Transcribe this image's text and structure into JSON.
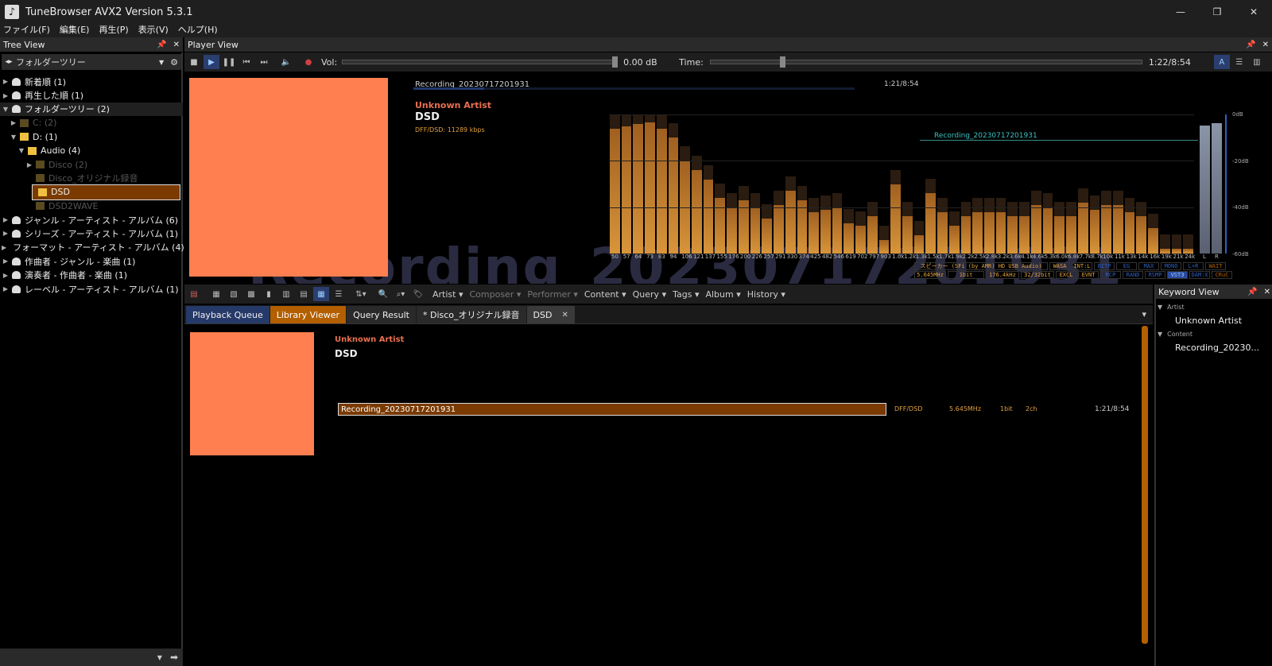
{
  "window": {
    "title": "TuneBrowser AVX2 Version 5.3.1",
    "minimize": "—",
    "restore": "❐",
    "close": "✕"
  },
  "menu": [
    "ファイル(F)",
    "編集(E)",
    "再生(P)",
    "表示(V)",
    "ヘルプ(H)"
  ],
  "tree": {
    "header": "Tree View",
    "dropdown_value": "フォルダーツリー",
    "items": [
      {
        "label": "新着順 (1)",
        "level": 0,
        "arrow": "▶",
        "icon": "root",
        "style": ""
      },
      {
        "label": "再生した順 (1)",
        "level": 0,
        "arrow": "▶",
        "icon": "root",
        "style": ""
      },
      {
        "label": "フォルダーツリー (2)",
        "level": 0,
        "arrow": "▼",
        "icon": "root",
        "style": "hl"
      },
      {
        "label": "C: (2)",
        "level": 1,
        "arrow": "▶",
        "icon": "dim",
        "style": "dim"
      },
      {
        "label": "D: (1)",
        "level": 1,
        "arrow": "▼",
        "icon": "folder",
        "style": ""
      },
      {
        "label": "Audio (4)",
        "level": 2,
        "arrow": "▼",
        "icon": "folder",
        "style": ""
      },
      {
        "label": "Disco (2)",
        "level": 3,
        "arrow": "▶",
        "icon": "dim",
        "style": "dim"
      },
      {
        "label": "Disco_オリジナル録音",
        "level": 3,
        "arrow": "",
        "icon": "dim",
        "style": "dim"
      },
      {
        "label": "DSD",
        "level": 3,
        "arrow": "",
        "icon": "folder",
        "style": "selected"
      },
      {
        "label": "DSD2WAVE",
        "level": 3,
        "arrow": "",
        "icon": "dim",
        "style": "dim"
      },
      {
        "label": "ジャンル - アーティスト - アルバム (6)",
        "level": 0,
        "arrow": "▶",
        "icon": "root",
        "style": ""
      },
      {
        "label": "シリーズ - アーティスト - アルバム (1)",
        "level": 0,
        "arrow": "▶",
        "icon": "root",
        "style": ""
      },
      {
        "label": "フォーマット - アーティスト - アルバム (4)",
        "level": 0,
        "arrow": "▶",
        "icon": "root",
        "style": ""
      },
      {
        "label": "作曲者 - ジャンル - 楽曲 (1)",
        "level": 0,
        "arrow": "▶",
        "icon": "root",
        "style": ""
      },
      {
        "label": "演奏者 - 作曲者 - 楽曲 (1)",
        "level": 0,
        "arrow": "▶",
        "icon": "root",
        "style": ""
      },
      {
        "label": "レーベル - アーティスト - アルバム (1)",
        "level": 0,
        "arrow": "▶",
        "icon": "root",
        "style": ""
      }
    ]
  },
  "player": {
    "header": "Player View",
    "vol_label": "Vol:",
    "vol_value": "0.00 dB",
    "vol_position": 0.99,
    "time_label": "Time:",
    "time_value": "1:22/8:54",
    "time_position": 0.16,
    "track_title": "Recording_20230717201931",
    "track_time": "1:21/8:54",
    "progress": 0.16,
    "artist": "Unknown Artist",
    "album": "DSD",
    "format": "DFF/DSD: 11289 kbps",
    "spectrum_title": "Recording_20230717201931",
    "watermark": "Recording_20230717201931",
    "db_labels": [
      "0dB",
      "-20dB",
      "-40dB",
      "-60dB"
    ],
    "freq_labels": [
      "50",
      "57",
      "64",
      "73",
      "83",
      "94",
      "106",
      "121",
      "137",
      "155",
      "176",
      "200",
      "226",
      "257",
      "291",
      "330",
      "374",
      "425",
      "482",
      "546",
      "619",
      "702",
      "797",
      "903",
      "1.0k",
      "1.2k",
      "1.3k",
      "1.5k",
      "1.7k",
      "1.9k",
      "2.2k",
      "2.5k",
      "2.8k",
      "3.2k",
      "3.6k",
      "4.1k",
      "4.6k",
      "5.3k",
      "6.0k",
      "6.8k",
      "7.7k",
      "8.7k",
      "10k",
      "11k",
      "13k",
      "14k",
      "16k",
      "19k",
      "21k",
      "24k"
    ],
    "spectrum_levels": [
      -6,
      -5,
      -4,
      -3.5,
      -6,
      -10,
      -20,
      -24,
      -28,
      -36,
      -40,
      -37,
      -40,
      -45,
      -39,
      -33,
      -37,
      -42,
      -41,
      -40,
      -47,
      -48,
      -44,
      -54,
      -30,
      -44,
      -52,
      -34,
      -42,
      -48,
      -44,
      -42,
      -42,
      -42,
      -44,
      -44,
      -39,
      -40,
      -44,
      -44,
      -38,
      -41,
      -39,
      -39,
      -42,
      -44,
      -49,
      -58,
      -58,
      -58
    ],
    "vu_channels": [
      "L",
      "R"
    ],
    "device_row1": [
      "スピーカー (SFi (by AMR) HD USB Audio)",
      "WASA",
      "INT:L",
      "BITP",
      "EG",
      "MAX",
      "MONO",
      "L+R",
      "WAIT"
    ],
    "device_row2": [
      "5.645MHz",
      "1bit",
      "176.4kHz",
      "32/32bit",
      "EXCL",
      "EVNT",
      "RCP",
      "RAND",
      "RSMP",
      "VST3",
      "DAM:X",
      "CRuC"
    ]
  },
  "library": {
    "toolbar_items": [
      {
        "label": "Artist ▾",
        "dim": false
      },
      {
        "label": "Composer ▾",
        "dim": true
      },
      {
        "label": "Performer ▾",
        "dim": true
      },
      {
        "label": "Content ▾",
        "dim": false
      },
      {
        "label": "Query ▾",
        "dim": false
      },
      {
        "label": "Tags ▾",
        "dim": false
      },
      {
        "label": "Album ▾",
        "dim": false
      },
      {
        "label": "History ▾",
        "dim": false
      }
    ],
    "tabs": [
      {
        "label": "Playback Queue",
        "style": "q"
      },
      {
        "label": "Library Viewer",
        "style": "lv"
      },
      {
        "label": "Query Result",
        "style": ""
      },
      {
        "label": "* Disco_オリジナル録音",
        "style": ""
      },
      {
        "label": "DSD",
        "style": "active"
      }
    ],
    "tab_close": "✕",
    "tab_menu": "▾",
    "artist": "Unknown Artist",
    "album": "DSD",
    "track": {
      "title": "Recording_20230717201931",
      "format": "DFF/DSD",
      "rate": "5.645MHz",
      "bits": "1bit",
      "channels": "2ch",
      "time": "1:21/8:54"
    }
  },
  "keyword": {
    "header": "Keyword View",
    "groups": [
      {
        "label": "Artist",
        "items": [
          "Unknown Artist"
        ]
      },
      {
        "label": "Content",
        "items": [
          "Recording_20230..."
        ]
      }
    ]
  },
  "colors": {
    "accent": "#b35f00",
    "cover": "#ff7f50",
    "artist": "#e87050",
    "format": "#e0a040",
    "queue_tab": "#263a6a"
  }
}
